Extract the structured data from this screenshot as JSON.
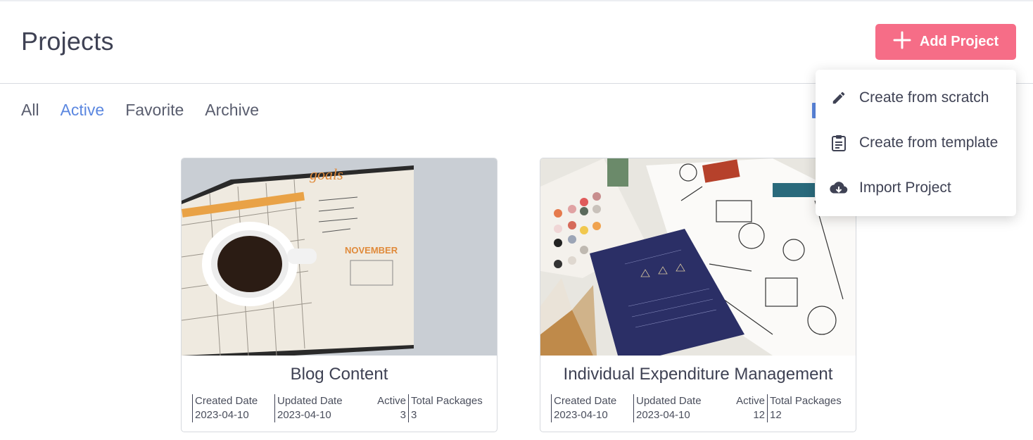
{
  "header": {
    "title": "Projects",
    "add_button_label": "Add Project"
  },
  "tabs": [
    {
      "label": "All",
      "active": false
    },
    {
      "label": "Active",
      "active": true
    },
    {
      "label": "Favorite",
      "active": false
    },
    {
      "label": "Archive",
      "active": false
    }
  ],
  "dropdown": {
    "items": [
      {
        "label": "Create from scratch",
        "icon": "pencil-icon"
      },
      {
        "label": "Create from template",
        "icon": "clipboard-icon"
      },
      {
        "label": "Import Project",
        "icon": "cloud-download-icon"
      }
    ]
  },
  "projects": [
    {
      "title": "Blog Content",
      "image": "coffee-planner-photo",
      "created_label": "Created Date",
      "created": "2023-04-10",
      "updated_label": "Updated Date",
      "updated": "2023-04-10",
      "active_label": "Active",
      "active": "3",
      "total_label": "Total Packages",
      "total": "3"
    },
    {
      "title": "Individual Expenditure Management",
      "image": "design-papers-photo",
      "created_label": "Created Date",
      "created": "2023-04-10",
      "updated_label": "Updated Date",
      "updated": "2023-04-10",
      "active_label": "Active",
      "active": "12",
      "total_label": "Total Packages",
      "total": "12"
    }
  ],
  "colors": {
    "accent_pink": "#f66d87",
    "active_tab": "#5b87e0",
    "text": "#3f4254"
  }
}
